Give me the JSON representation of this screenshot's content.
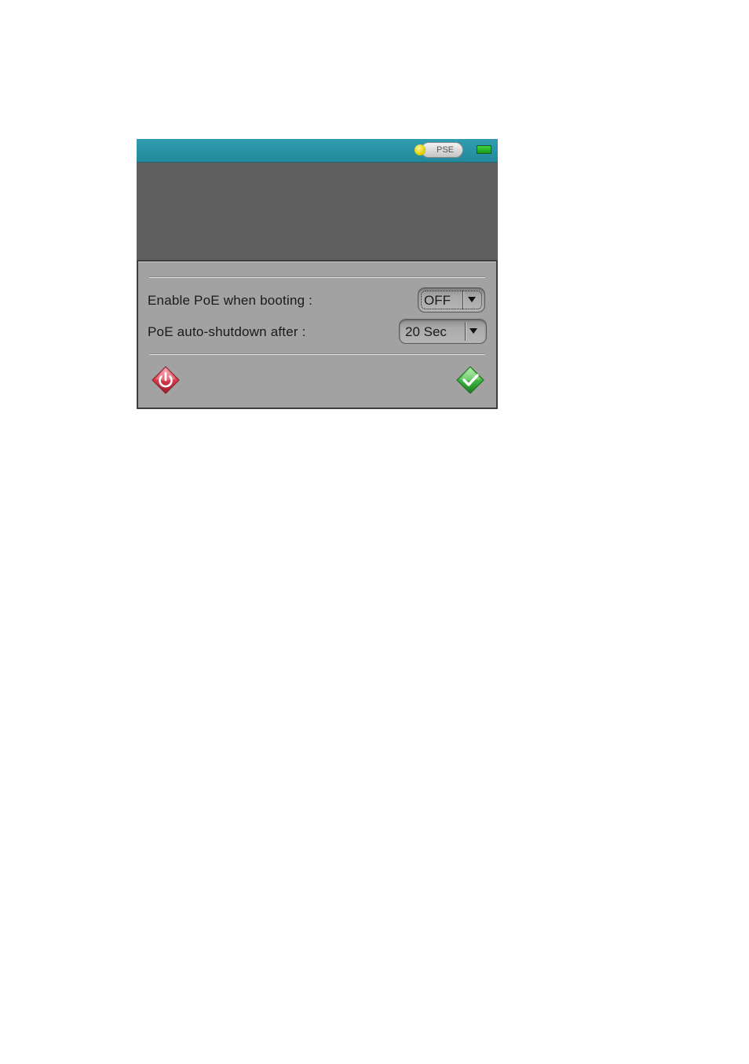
{
  "statusbar": {
    "mode_label": "PSE",
    "led_color": "#e0d000",
    "battery_color": "#2bb52b",
    "battery_icon": "battery-icon"
  },
  "dialog": {
    "rows": [
      {
        "label": "Enable PoE when booting :",
        "value": "OFF"
      },
      {
        "label": "PoE auto-shutdown after :",
        "value": "20 Sec"
      }
    ],
    "cancel_icon": "power-cancel-icon",
    "confirm_icon": "checkmark-confirm-icon",
    "cancel_color": "#d03a4a",
    "confirm_color": "#3fb83f"
  }
}
